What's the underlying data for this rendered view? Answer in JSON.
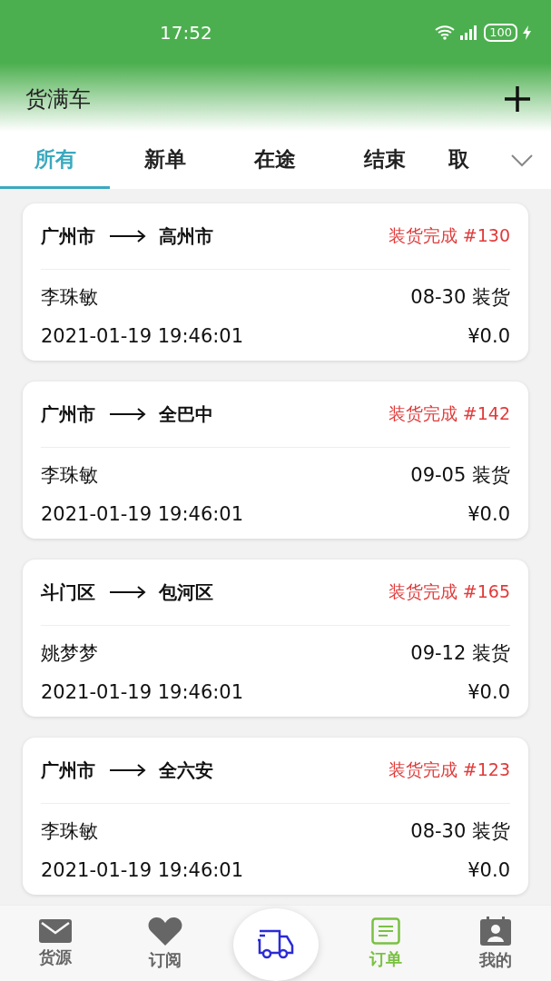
{
  "status_bar": {
    "time": "17:52",
    "battery": "100"
  },
  "header": {
    "title": "货满车"
  },
  "tabs": [
    {
      "label": "所有",
      "selected": true
    },
    {
      "label": "新单",
      "selected": false
    },
    {
      "label": "在途",
      "selected": false
    },
    {
      "label": "结束",
      "selected": false
    },
    {
      "label": "取",
      "selected": false
    }
  ],
  "orders": [
    {
      "from": "广州市",
      "to": "高州市",
      "status": "装货完成 #130",
      "name": "李珠敏",
      "load_date": "08-30 装货",
      "created": "2021-01-19 19:46:01",
      "price": "¥0.0"
    },
    {
      "from": "广州市",
      "to": "全巴中",
      "status": "装货完成 #142",
      "name": "李珠敏",
      "load_date": "09-05 装货",
      "created": "2021-01-19 19:46:01",
      "price": "¥0.0"
    },
    {
      "from": "斗门区",
      "to": "包河区",
      "status": "装货完成 #165",
      "name": "姚梦梦",
      "load_date": "09-12 装货",
      "created": "2021-01-19 19:46:01",
      "price": "¥0.0"
    },
    {
      "from": "广州市",
      "to": "全六安",
      "status": "装货完成 #123",
      "name": "李珠敏",
      "load_date": "08-30 装货",
      "created": "2021-01-19 19:46:01",
      "price": "¥0.0"
    }
  ],
  "bottom_nav": [
    {
      "kind": "mail",
      "label": "货源",
      "selected": false
    },
    {
      "kind": "heart",
      "label": "订阅",
      "selected": false
    },
    {
      "kind": "truck",
      "selected": false
    },
    {
      "kind": "doc",
      "label": "订单",
      "selected": true
    },
    {
      "kind": "person",
      "label": "我的",
      "selected": false
    }
  ]
}
